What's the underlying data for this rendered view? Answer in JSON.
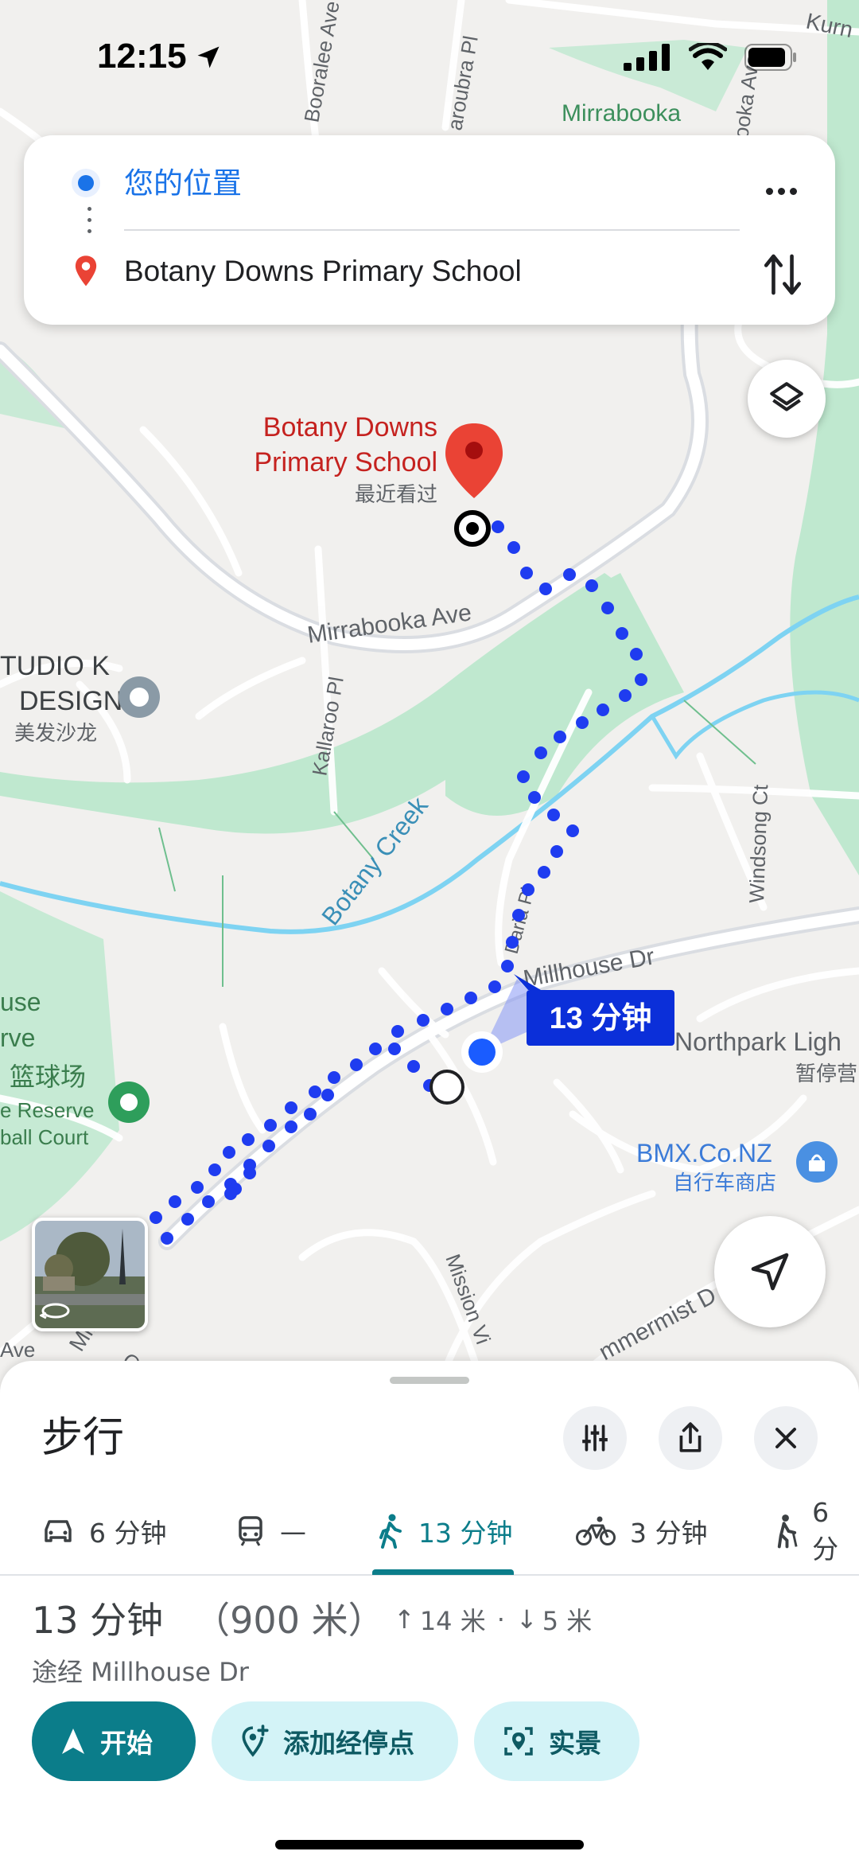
{
  "status_bar": {
    "time": "12:15"
  },
  "route_card": {
    "origin": "您的位置",
    "destination": "Botany Downs Primary School"
  },
  "map": {
    "streets": {
      "mirrabooka_ave": "Mirrabooka Ave",
      "kallaroo_pl": "Kallaroo Pl",
      "botany_creek": "Botany Creek",
      "daria_pl": "Daria Pl",
      "millhouse_dr": "Millhouse Dr",
      "windsong_ct": "Windsong Ct",
      "mission_view": "Mission Vi",
      "summermist": "mmermist D",
      "booralee_ave": "Booralee Ave",
      "aroubra_pl": "aroubra Pl",
      "kurn": "Kurn",
      "ooka_ave": "ooka Ave",
      "mirrabooka_park": "Mirrabooka",
      "millhouse_sw": "Millhouse Dr",
      "ave_left": "Ave",
      "orr": "Or"
    },
    "destination_label_1": "Botany Downs",
    "destination_label_2": "Primary School",
    "destination_note": "最近看过",
    "poi_studio_1": "TUDIO K",
    "poi_studio_2": "DESIGN",
    "poi_studio_3": "美发沙龙",
    "poi_reserve_1": "use",
    "poi_reserve_2": "rve",
    "poi_reserve_3": "篮球场",
    "poi_reserve_4": "e Reserve",
    "poi_reserve_5": "ball Court",
    "poi_northpark_1": "Northpark Ligh",
    "poi_northpark_2": "暂停营",
    "poi_bmx_1": "BMX.Co.NZ",
    "poi_bmx_2": "自行车商店",
    "duration_badge": "13 分钟",
    "colors": {
      "route": "#1f3cf0",
      "badge": "#0b2fd9",
      "park": "#bfe8cf",
      "water": "#7ed3f2"
    }
  },
  "sheet": {
    "title": "步行",
    "modes": [
      {
        "icon": "car-icon",
        "label": "6 分钟"
      },
      {
        "icon": "transit-icon",
        "label": "—"
      },
      {
        "icon": "walk-icon",
        "label": "13 分钟",
        "active": true
      },
      {
        "icon": "bike-icon",
        "label": "3 分钟"
      },
      {
        "icon": "wheelchair-walk-icon",
        "label": "6 分"
      }
    ],
    "summary_time": "13 分钟",
    "summary_distance": "（900 米）",
    "elevation_up": "14 米",
    "elevation_sep": "·",
    "elevation_down": "5 米",
    "via": "途经 Millhouse Dr",
    "buttons": {
      "start": "开始",
      "add_stop": "添加经停点",
      "street_view": "实景"
    }
  }
}
